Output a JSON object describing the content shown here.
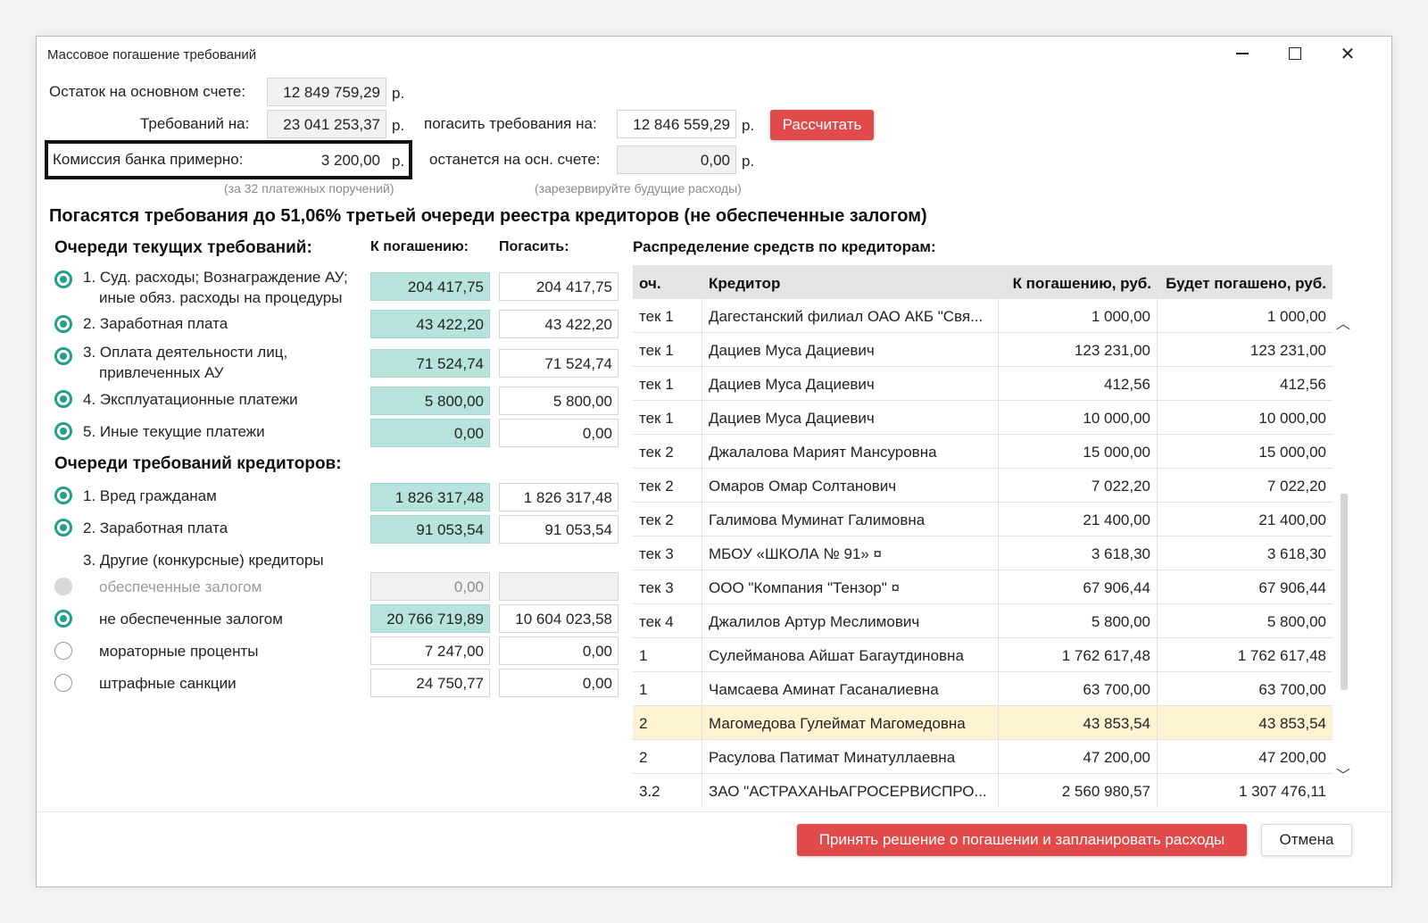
{
  "window": {
    "title": "Массовое погашение требований"
  },
  "summary": {
    "balance_label": "Остаток на основном счете:",
    "balance_value": "12 849 759,29",
    "claims_label": "Требований на:",
    "claims_value": "23 041 253,37",
    "commission_label": "Комиссия банка примерно:",
    "commission_value": "3 200,00",
    "currency": "р.",
    "commission_note": "(за 32 платежных поручений)",
    "pay_label": "погасить требования на:",
    "pay_value": "12 846 559,29",
    "remain_label": "останется на осн. счете:",
    "remain_value": "0,00",
    "remain_note": "(зарезервируйте будущие расходы)",
    "calc_button": "Рассчитать"
  },
  "headline": "Погасятся требования до 51,06% третьей очереди реестра кредиторов (не обеспеченные залогом)",
  "current_queues": {
    "title": "Очереди текущих требований:",
    "col_due": "К погашению:",
    "col_pay": "Погасить:",
    "items": [
      {
        "line1": "1. Суд. расходы; Вознаграждение АУ;",
        "line2": "иные обяз. расходы на процедуры",
        "due": "204 417,75",
        "pay": "204 417,75"
      },
      {
        "line1": "2. Заработная плата",
        "due": "43 422,20",
        "pay": "43 422,20"
      },
      {
        "line1": "3. Оплата деятельности лиц,",
        "line2": "привлеченных АУ",
        "due": "71 524,74",
        "pay": "71 524,74"
      },
      {
        "line1": "4. Эксплуатационные платежи",
        "due": "5 800,00",
        "pay": "5 800,00"
      },
      {
        "line1": "5. Иные текущие платежи",
        "due": "0,00",
        "pay": "0,00"
      }
    ]
  },
  "creditor_queues": {
    "title": "Очереди требований кредиторов:",
    "items": [
      {
        "label": "1. Вред гражданам",
        "due": "1 826 317,48",
        "pay": "1 826 317,48"
      },
      {
        "label": "2. Заработная плата",
        "due": "91 053,54",
        "pay": "91 053,54"
      },
      {
        "label": "3. Другие (конкурсные) кредиторы"
      },
      {
        "label": "обеспеченные залогом",
        "due": "0,00",
        "pay": ""
      },
      {
        "label": "не обеспеченные залогом",
        "due": "20 766 719,89",
        "pay": "10 604 023,58"
      },
      {
        "label": "мораторные проценты",
        "due": "7 247,00",
        "pay": "0,00"
      },
      {
        "label": "штрафные санкции",
        "due": "24 750,77",
        "pay": "0,00"
      }
    ]
  },
  "distribution": {
    "title": "Распределение средств по кредиторам:",
    "columns": [
      "оч.",
      "Кредитор",
      "К погашению, руб.",
      "Будет погашено, руб."
    ],
    "rows": [
      [
        "тек 1",
        "Дагестанский филиал ОАО АКБ \"Свя...",
        "1 000,00",
        "1 000,00"
      ],
      [
        "тек 1",
        "Дациев Муса Дациевич",
        "123 231,00",
        "123 231,00"
      ],
      [
        "тек 1",
        "Дациев Муса Дациевич",
        "412,56",
        "412,56"
      ],
      [
        "тек 1",
        "Дациев Муса Дациевич",
        "10 000,00",
        "10 000,00"
      ],
      [
        "тек 2",
        "Джалалова Марият Мансуровна",
        "15 000,00",
        "15 000,00"
      ],
      [
        "тек 2",
        "Омаров Омар Солтанович",
        "7 022,20",
        "7 022,20"
      ],
      [
        "тек 2",
        "Галимова Муминат Галимовна",
        "21 400,00",
        "21 400,00"
      ],
      [
        "тек 3",
        "МБОУ «ШКОЛА № 91» ¤",
        "3 618,30",
        "3 618,30"
      ],
      [
        "тек 3",
        "ООО \"Компания \"Тензор\" ¤",
        "67 906,44",
        "67 906,44"
      ],
      [
        "тек 4",
        "Джалилов Артур Меслимович",
        "5 800,00",
        "5 800,00"
      ],
      [
        "1",
        "Сулейманова Айшат Багаутдиновна",
        "1 762 617,48",
        "1 762 617,48"
      ],
      [
        "1",
        "Чамсаева Аминат Гасаналиевна",
        "63 700,00",
        "63 700,00"
      ],
      [
        "2",
        "Магомедова Гулеймат Магомедовна",
        "43 853,54",
        "43 853,54"
      ],
      [
        "2",
        "Расулова Патимат Минатуллаевна",
        "47 200,00",
        "47 200,00"
      ],
      [
        "3.2",
        "ЗАО \"АСТРАХАНЬАГРОСЕРВИСПРО...",
        "2 560 980,57",
        "1 307 476,11"
      ]
    ],
    "selected_row": 12
  },
  "footer": {
    "accept_button": "Принять решение о погашении и запланировать расходы",
    "cancel_button": "Отмена"
  },
  "colors": {
    "accent_red": "#e04a4a",
    "teal": "#22a08c",
    "green_field": "#b6e3db",
    "selected_row": "#fdf3d2"
  }
}
